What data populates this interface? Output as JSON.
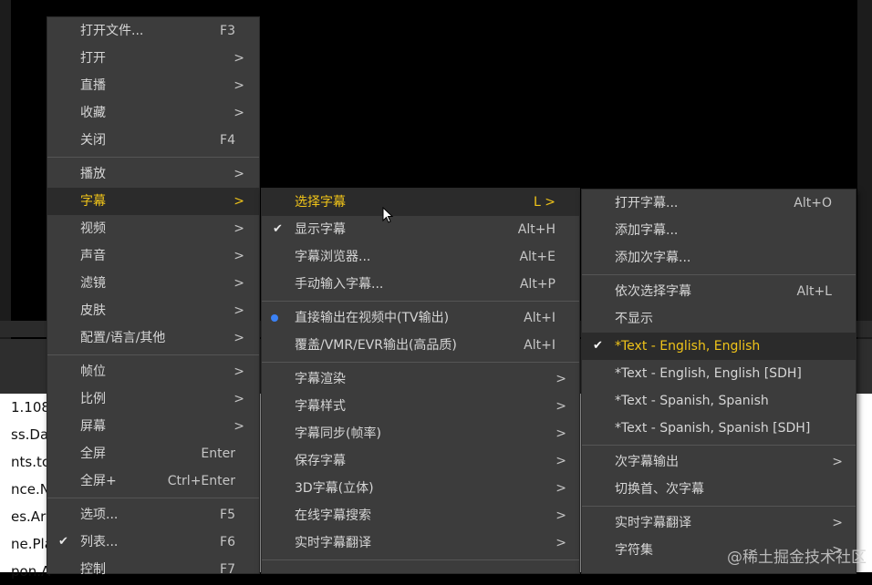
{
  "background": {
    "list_items": [
      "1.108",
      "ss.Da",
      "nts.tc",
      "nce.N",
      "es.Ar",
      "ne.Pla",
      "pon.A"
    ]
  },
  "main_menu": {
    "items": [
      {
        "label": "打开文件...",
        "shortcut": "F3"
      },
      {
        "label": "打开",
        "arrow": ">"
      },
      {
        "label": "直播",
        "arrow": ">"
      },
      {
        "label": "收藏",
        "arrow": ">"
      },
      {
        "label": "关闭",
        "shortcut": "F4"
      },
      {
        "label": "播放",
        "arrow": ">"
      },
      {
        "label": "字幕",
        "arrow": ">"
      },
      {
        "label": "视频",
        "arrow": ">"
      },
      {
        "label": "声音",
        "arrow": ">"
      },
      {
        "label": "滤镜",
        "arrow": ">"
      },
      {
        "label": "皮肤",
        "arrow": ">"
      },
      {
        "label": "配置/语言/其他",
        "arrow": ">"
      },
      {
        "label": "帧位",
        "arrow": ">"
      },
      {
        "label": "比例",
        "arrow": ">"
      },
      {
        "label": "屏幕",
        "arrow": ">"
      },
      {
        "label": "全屏",
        "shortcut": "Enter"
      },
      {
        "label": "全屏+",
        "shortcut": "Ctrl+Enter"
      },
      {
        "label": "选项...",
        "shortcut": "F5"
      },
      {
        "label": "列表...",
        "shortcut": "F6"
      },
      {
        "label": "控制",
        "shortcut": "F7"
      }
    ]
  },
  "subtitle_menu": {
    "items": [
      {
        "label": "选择字幕",
        "shortcut": "L >"
      },
      {
        "label": "显示字幕",
        "shortcut": "Alt+H"
      },
      {
        "label": "字幕浏览器...",
        "shortcut": "Alt+E"
      },
      {
        "label": "手动输入字幕...",
        "shortcut": "Alt+P"
      },
      {
        "label": "直接输出在视频中(TV输出)",
        "shortcut": "Alt+I"
      },
      {
        "label": "覆盖/VMR/EVR输出(高品质)",
        "shortcut": "Alt+I"
      },
      {
        "label": "字幕渲染",
        "arrow": ">"
      },
      {
        "label": "字幕样式",
        "arrow": ">"
      },
      {
        "label": "字幕同步(帧率)",
        "arrow": ">"
      },
      {
        "label": "保存字幕",
        "arrow": ">"
      },
      {
        "label": "3D字幕(立体)",
        "arrow": ">"
      },
      {
        "label": "在线字幕搜索",
        "arrow": ">"
      },
      {
        "label": "实时字幕翻译",
        "arrow": ">"
      }
    ]
  },
  "select_menu": {
    "items": [
      {
        "label": "打开字幕...",
        "shortcut": "Alt+O"
      },
      {
        "label": "添加字幕..."
      },
      {
        "label": "添加次字幕..."
      },
      {
        "label": "依次选择字幕",
        "shortcut": "Alt+L"
      },
      {
        "label": "不显示"
      },
      {
        "label": "*Text - English, English"
      },
      {
        "label": "*Text - English, English [SDH]"
      },
      {
        "label": "*Text - Spanish, Spanish"
      },
      {
        "label": "*Text - Spanish, Spanish [SDH]"
      },
      {
        "label": "次字幕输出",
        "arrow": ">"
      },
      {
        "label": "切换首、次字幕"
      },
      {
        "label": "实时字幕翻译",
        "arrow": ">"
      },
      {
        "label": "字符集",
        "arrow": ">"
      }
    ]
  },
  "watermark": "@稀土掘金技术社区",
  "colors": {
    "active": "#f0c419",
    "menu_bg": "#3c3c3c",
    "radio": "#3b82f6"
  }
}
